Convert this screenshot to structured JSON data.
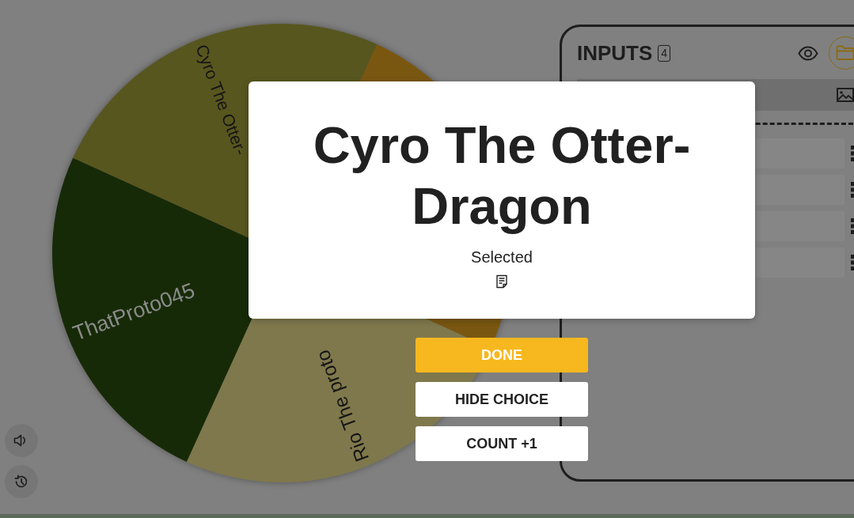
{
  "wheel": {
    "segments": [
      {
        "label": "Cyro The Otter-",
        "color": "#58561f"
      },
      {
        "color": "#7a5710"
      },
      {
        "label": "Rio The proto",
        "color": "#7f784c"
      },
      {
        "label": "ThatProto045",
        "color": "#162a07"
      }
    ]
  },
  "side_buttons": [
    {
      "kind": "sound"
    },
    {
      "kind": "history"
    }
  ],
  "inputs": {
    "title": "INPUTS",
    "count": "4",
    "entries": [
      {
        "kind": "text"
      },
      {
        "kind": "text"
      },
      {
        "kind": "text"
      },
      {
        "kind": "text"
      }
    ]
  },
  "result": {
    "title": "Cyro The Otter-Dragon",
    "subtitle": "Selected",
    "actions": [
      {
        "label": "DONE",
        "kind": "done"
      },
      {
        "label": "HIDE CHOICE",
        "kind": "hide"
      },
      {
        "label": "COUNT +1",
        "kind": "count"
      }
    ]
  }
}
